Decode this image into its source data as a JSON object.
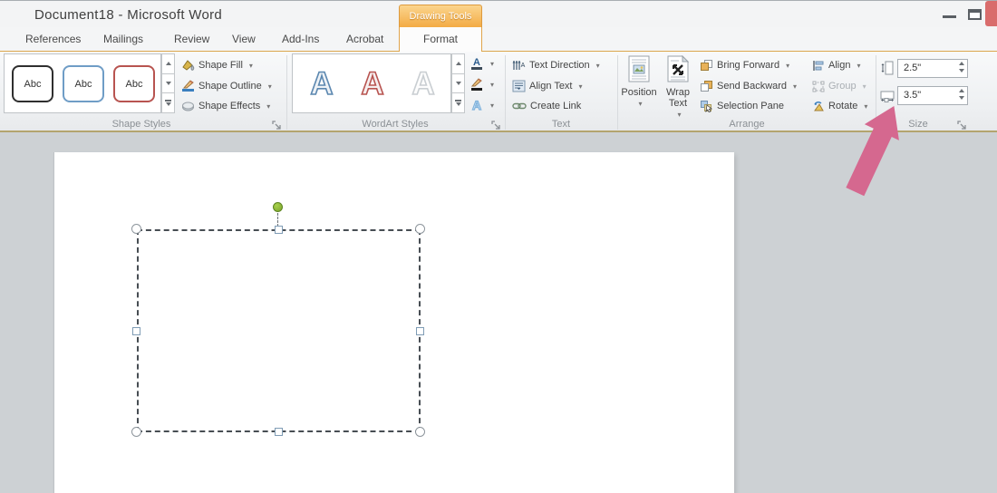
{
  "window": {
    "title": "Document18 - Microsoft Word"
  },
  "contextual_tab": {
    "label": "Drawing Tools"
  },
  "tabs": [
    {
      "label": "References"
    },
    {
      "label": "Mailings"
    },
    {
      "label": "Review"
    },
    {
      "label": "View"
    },
    {
      "label": "Add-Ins"
    },
    {
      "label": "Acrobat"
    },
    {
      "label": "Format",
      "active": true
    }
  ],
  "ribbon": {
    "shape_styles": {
      "label": "Shape Styles",
      "gallery": [
        {
          "label": "Abc",
          "outline": "#2f2f2f"
        },
        {
          "label": "Abc",
          "outline": "#6f9dc6"
        },
        {
          "label": "Abc",
          "outline": "#b85450"
        }
      ],
      "buttons": [
        {
          "label": "Shape Fill"
        },
        {
          "label": "Shape Outline"
        },
        {
          "label": "Shape Effects"
        }
      ]
    },
    "wordart_styles": {
      "label": "WordArt Styles",
      "gallery": [
        {
          "label": "A",
          "stroke": "#5b87b0"
        },
        {
          "label": "A",
          "stroke": "#b85450"
        },
        {
          "label": "A",
          "stroke": "#c9ced2"
        }
      ]
    },
    "text_group": {
      "label": "Text",
      "items": [
        {
          "label": "Text Direction"
        },
        {
          "label": "Align Text"
        },
        {
          "label": "Create Link"
        }
      ]
    },
    "arrange": {
      "label": "Arrange",
      "big_buttons": [
        {
          "label": "Position"
        },
        {
          "label": "Wrap Text"
        }
      ],
      "items_col1": [
        {
          "label": "Bring Forward"
        },
        {
          "label": "Send Backward"
        },
        {
          "label": "Selection Pane"
        }
      ],
      "items_col2": [
        {
          "label": "Align"
        },
        {
          "label": "Group",
          "disabled": true
        },
        {
          "label": "Rotate"
        }
      ]
    },
    "size": {
      "label": "Size",
      "height_value": "2.5\"",
      "width_value": "3.5\""
    }
  },
  "colors": {
    "contextual_orange": "#f3ab44",
    "ribbon_bottom_gold": "#b3a46e",
    "annotation_arrow_pink": "#d5688f",
    "rotate_handle_green": "#83ad33",
    "close_button_red": "#d96c6c"
  }
}
